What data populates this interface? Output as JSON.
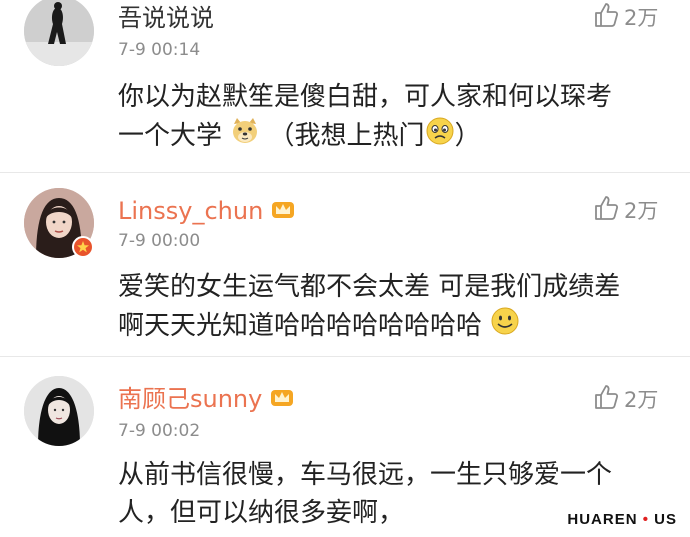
{
  "comments": [
    {
      "username": "吾说说说",
      "time": "7-9 00:14",
      "likes": "2万",
      "text_line1": "你以为赵默笙是傻白甜，可人家和何以琛考",
      "text_line2_a": "一个大学",
      "text_line2_b": "（我想上热门",
      "text_line2_c": "）",
      "vip": false,
      "emojis": [
        "doge-emoji",
        "sad-emoji"
      ]
    },
    {
      "username": "Linssy_chun",
      "time": "7-9 00:00",
      "likes": "2万",
      "text_line1": "爱笑的女生运气都不会太差 可是我们成绩差",
      "text_line2_a": "啊天天光知道哈哈哈哈哈哈哈哈",
      "vip": true,
      "emojis": [
        "smile-emoji"
      ]
    },
    {
      "username": "南顾己sunny",
      "time": "7-9 00:02",
      "likes": "2万",
      "text_line1": "从前书信很慢，车马很远，一生只够爱一个",
      "text_line2_a": "人，但可以纳很多妾啊，",
      "vip": true,
      "emojis": []
    }
  ],
  "watermark": {
    "part1": "HUAREN",
    "dot": "•",
    "part2": "US"
  },
  "colors": {
    "vip_name": "#eb7350",
    "meta_gray": "#8c8c8c",
    "text": "#222222"
  }
}
